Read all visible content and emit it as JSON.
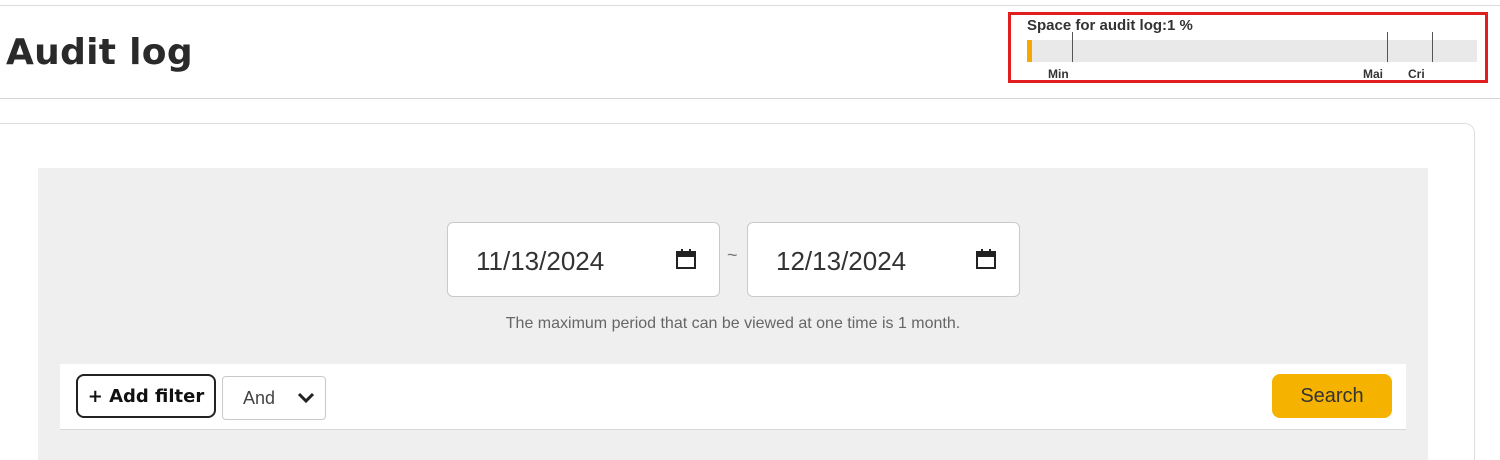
{
  "header": {
    "title": "Audit log"
  },
  "usage_meter": {
    "label": "Space for audit log:1 %",
    "used_percent": 1,
    "bar_color": "#f5a800",
    "markers": [
      {
        "label": "Min",
        "position_percent": 10
      },
      {
        "label": "Mai",
        "position_percent": 80
      },
      {
        "label": "Cri",
        "position_percent": 90
      }
    ]
  },
  "date_range": {
    "start_date": "11/13/2024",
    "end_date": "12/13/2024",
    "separator": "~",
    "note": "The maximum period that can be viewed at one time is 1 month."
  },
  "filter_bar": {
    "add_filter_label": "+ Add filter",
    "logic_selected": "And",
    "search_label": "Search"
  },
  "icons": {
    "date_picker": "calendar-icon",
    "select": "chevron-down-icon"
  },
  "colors": {
    "accent": "#f5b300",
    "highlight_border": "#e01e1e"
  }
}
